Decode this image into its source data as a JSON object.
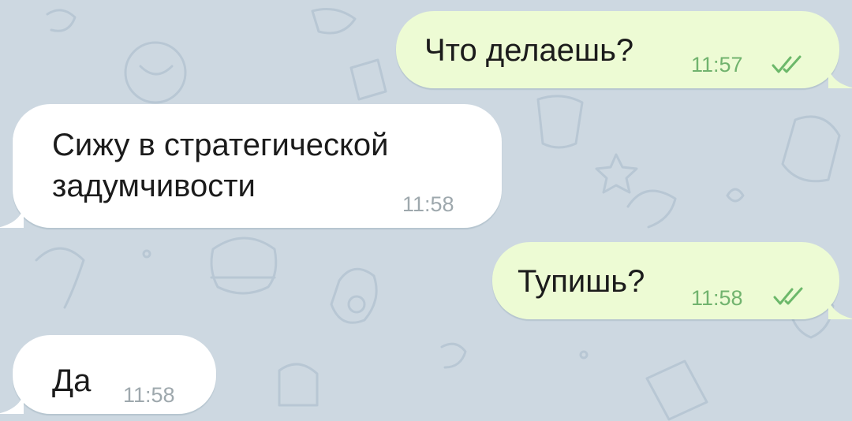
{
  "chat": {
    "messages": [
      {
        "direction": "outgoing",
        "text": "Что делаешь?",
        "time": "11:57",
        "status": "read"
      },
      {
        "direction": "incoming",
        "text": "Сижу в стратегической\nзадумчивости",
        "time": "11:58"
      },
      {
        "direction": "outgoing",
        "text": "Тупишь?",
        "time": "11:58",
        "status": "read"
      },
      {
        "direction": "incoming",
        "text": "Да",
        "time": "11:58"
      }
    ]
  },
  "colors": {
    "background": "#cdd8e1",
    "outgoing_bubble": "#edfbd4",
    "incoming_bubble": "#ffffff",
    "outgoing_meta": "#71b36e",
    "incoming_meta": "#9ea8ad",
    "message_text": "#1b1b1b"
  },
  "icons": {
    "read_status": "double-check-icon",
    "wallpaper": "doodle-pattern"
  }
}
